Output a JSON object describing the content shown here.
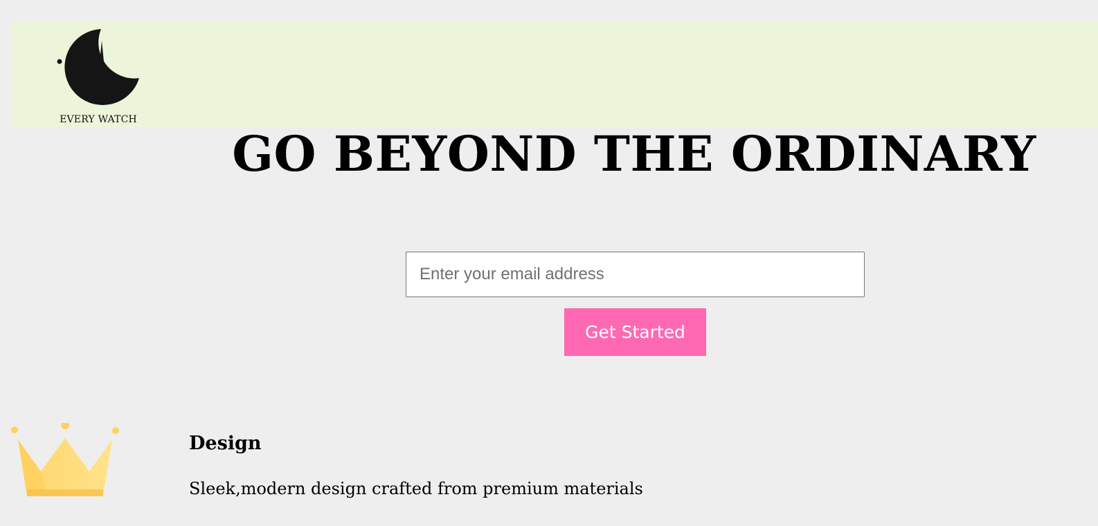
{
  "header": {
    "logo": {
      "icon": "clock-crescent-icon",
      "text": "EVERY WATCH"
    }
  },
  "hero": {
    "title": "GO BEYOND THE ORDINARY",
    "email_placeholder": "Enter your email address",
    "email_value": "",
    "cta_label": "Get Started"
  },
  "features": [
    {
      "icon": "crown-icon",
      "title": "Design",
      "description": "Sleek,modern design crafted from premium materials"
    }
  ],
  "colors": {
    "background": "#eeeeee",
    "header_bg": "#ecf5d9",
    "accent": "#ff69b4",
    "crown": "#ffd66b"
  }
}
